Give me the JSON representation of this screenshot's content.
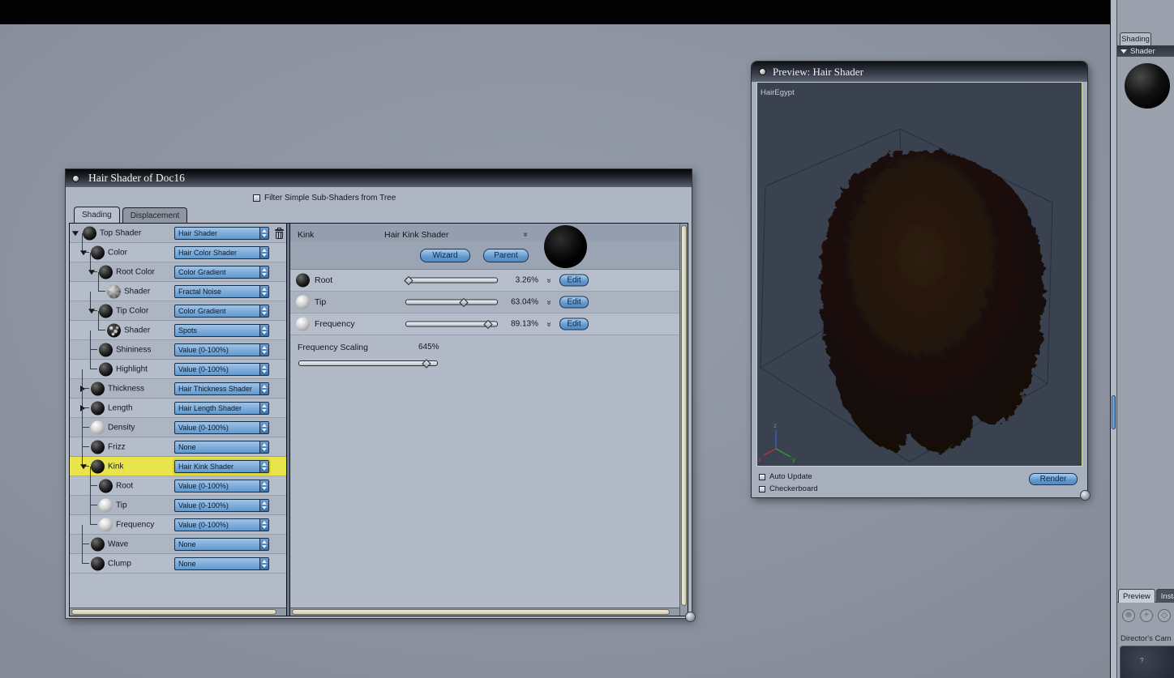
{
  "icons": {
    "double_chevron": "»",
    "nav_icon_1": "⊕",
    "nav_icon_2": "+",
    "nav_icon_3": "◇",
    "camera_dot": "?"
  },
  "colors": {
    "accent_blue": "#6298cc",
    "selection_yellow": "#e9e34c",
    "viewport_bg": "#3a4250",
    "hair_brown": "#1d1009"
  },
  "dialog": {
    "title": "Hair Shader of Doc16",
    "filter_label": "Filter Simple Sub-Shaders from Tree",
    "tabs": [
      {
        "label": "Shading",
        "active": true
      },
      {
        "label": "Displacement",
        "active": false
      }
    ],
    "tree": [
      {
        "label": "Top Shader",
        "value": "Hair Shader",
        "level": 0,
        "expander": "down",
        "sphere": "black",
        "trash": true
      },
      {
        "label": "Color",
        "value": "Hair Color Shader",
        "level": 1,
        "expander": "down",
        "sphere": "black"
      },
      {
        "label": "Root Color",
        "value": "Color Gradient",
        "level": 2,
        "expander": "down",
        "sphere": "black"
      },
      {
        "label": "Shader",
        "value": "Fractal Noise",
        "level": 3,
        "sphere": "noise"
      },
      {
        "label": "Tip Color",
        "value": "Color Gradient",
        "level": 2,
        "expander": "down",
        "sphere": "black"
      },
      {
        "label": "Shader",
        "value": "Spots",
        "level": 3,
        "sphere": "spots"
      },
      {
        "label": "Shininess",
        "value": "Value (0-100%)",
        "level": 2,
        "sphere": "black"
      },
      {
        "label": "Highlight",
        "value": "Value (0-100%)",
        "level": 2,
        "sphere": "black"
      },
      {
        "label": "Thickness",
        "value": "Hair Thickness Shader",
        "level": 1,
        "expander": "right",
        "sphere": "black"
      },
      {
        "label": "Length",
        "value": "Hair Length Shader",
        "level": 1,
        "expander": "right",
        "sphere": "black"
      },
      {
        "label": "Density",
        "value": "Value (0-100%)",
        "level": 1,
        "sphere": "light"
      },
      {
        "label": "Frizz",
        "value": "None",
        "level": 1,
        "sphere": "black"
      },
      {
        "label": "Kink",
        "value": "Hair Kink Shader",
        "level": 1,
        "expander": "down",
        "sphere": "black",
        "highlighted": true
      },
      {
        "label": "Root",
        "value": "Value (0-100%)",
        "level": 2,
        "sphere": "black"
      },
      {
        "label": "Tip",
        "value": "Value (0-100%)",
        "level": 2,
        "sphere": "light"
      },
      {
        "label": "Frequency",
        "value": "Value (0-100%)",
        "level": 2,
        "sphere": "light"
      },
      {
        "label": "Wave",
        "value": "None",
        "level": 1,
        "sphere": "black"
      },
      {
        "label": "Clump",
        "value": "None",
        "level": 1,
        "sphere": "black"
      }
    ],
    "detail": {
      "selected_label": "Kink",
      "shader_name": "Hair Kink Shader",
      "wizard_button": "Wizard",
      "parent_button": "Parent",
      "params": [
        {
          "label": "Root",
          "value": "3.26%",
          "pct": 3.26,
          "edit": "Edit",
          "sphere": "black"
        },
        {
          "label": "Tip",
          "value": "63.04%",
          "pct": 63.04,
          "edit": "Edit",
          "sphere": "light"
        },
        {
          "label": "Frequency",
          "value": "89.13%",
          "pct": 89.13,
          "edit": "Edit",
          "sphere": "light"
        }
      ],
      "frequency_scaling": {
        "label": "Frequency Scaling",
        "value": "645%",
        "pct": 92
      }
    }
  },
  "preview": {
    "title": "Preview: Hair Shader",
    "object_label": "HairEgypt",
    "auto_update_label": "Auto Update",
    "checkerboard_label": "Checkerboard",
    "render_button": "Render",
    "axis": {
      "x": "x",
      "y": "y",
      "z": "z"
    }
  },
  "sidebar": {
    "shading_tab": "Shading",
    "shader_section": "Shader",
    "preview_tab": "Preview",
    "instances_tab": "Instan",
    "camera_label": "Director's Cam"
  }
}
